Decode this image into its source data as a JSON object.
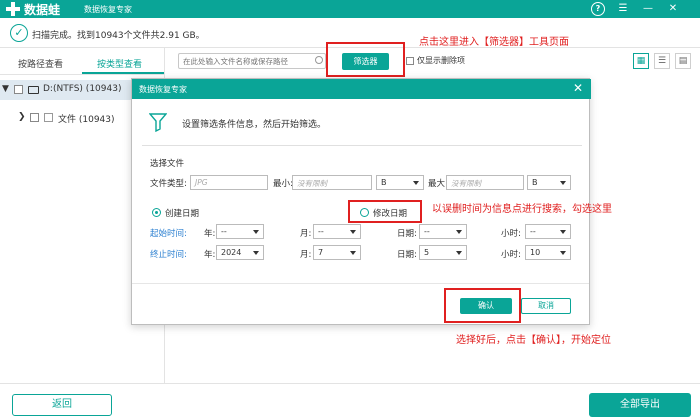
{
  "app": {
    "name": "数据蛙",
    "subtitle": "数据恢复专家"
  },
  "scan": {
    "status": "扫描完成。找到10943个文件共2.91 GB。"
  },
  "tabs": [
    {
      "label": "按路径查看",
      "active": false
    },
    {
      "label": "按类型查看",
      "active": true
    }
  ],
  "tree": {
    "drive_label": "D:(NTFS) (10943)",
    "file_label": "文件 (10943)"
  },
  "toolbar": {
    "search_placeholder": "在此处输入文件名称或保存路径",
    "filter_label": "筛选器",
    "only_deleted_label": "仅显示删除项"
  },
  "dialog": {
    "title": "数据恢复专家",
    "info": "设置筛选条件信息，然后开始筛选。",
    "section_label": "选择文件",
    "file_type_label": "文件类型:",
    "file_type_placeholder": "JPG",
    "min_label": "最小:",
    "min_placeholder": "没有限制",
    "min_unit": "B",
    "max_label": "最大:",
    "max_placeholder": "没有限制",
    "max_unit": "B",
    "radio_created": "创建日期",
    "radio_modified": "修改日期",
    "selected_radio": "created",
    "start_label": "起始时间:",
    "end_label": "终止时间:",
    "year_label": "年:",
    "month_label": "月:",
    "day_label": "日期:",
    "hour_label": "小时:",
    "start": {
      "year": "--",
      "month": "--",
      "day": "--",
      "hour": "--"
    },
    "end": {
      "year": "2024",
      "month": "7",
      "day": "5",
      "hour": "10"
    },
    "ok_label": "确认",
    "cancel_label": "取消"
  },
  "footer": {
    "back_label": "返回",
    "export_label": "全部导出"
  },
  "annotations": {
    "a1": "点击这里进入【筛选器】工具页面",
    "a2": "以误删时间为信息点进行搜索，勾选这里",
    "a3": "选择好后，点击【确认】，开始定位"
  },
  "colors": {
    "accent": "#0aa597",
    "annotation": "#e02020",
    "link_blue": "#2b7fd0"
  }
}
